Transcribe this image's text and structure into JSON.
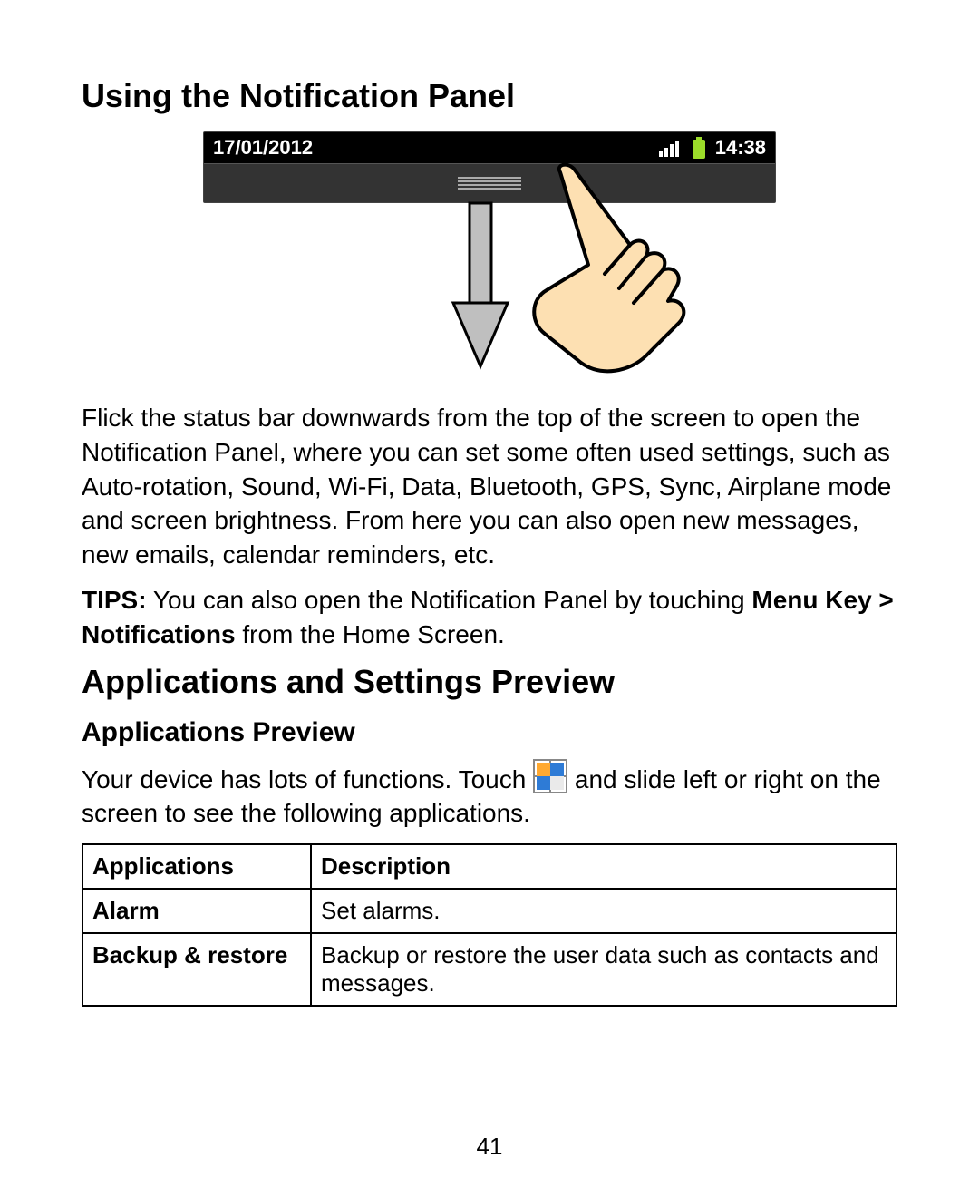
{
  "heading1": "Using the Notification Panel",
  "statusbar": {
    "date": "17/01/2012",
    "time": "14:38"
  },
  "para1": "Flick the status bar downwards from the top of the screen to open the Notification Panel, where you can set some often used settings, such as Auto-rotation, Sound, Wi-Fi, Data, Bluetooth, GPS, Sync, Airplane mode and screen brightness. From here you can also open new messages, new emails, calendar reminders, etc.",
  "tips_label": "TIPS:",
  "tips_text": " You can also open the Notification Panel by touching ",
  "tips_path": "Menu Key > Notifications",
  "tips_tail": " from the Home Screen.",
  "heading2": "Applications and Settings Preview",
  "heading3": "Applications Preview",
  "para2_a": "Your device has lots of functions. Touch ",
  "para2_b": " and slide left or right on the screen to see the following applications.",
  "table": {
    "headers": {
      "col1": "Applications",
      "col2": "Description"
    },
    "rows": [
      {
        "app": "Alarm",
        "desc": "Set alarms."
      },
      {
        "app": "Backup & restore",
        "desc": "Backup or restore the user data such as contacts and messages."
      }
    ]
  },
  "page_number": "41"
}
